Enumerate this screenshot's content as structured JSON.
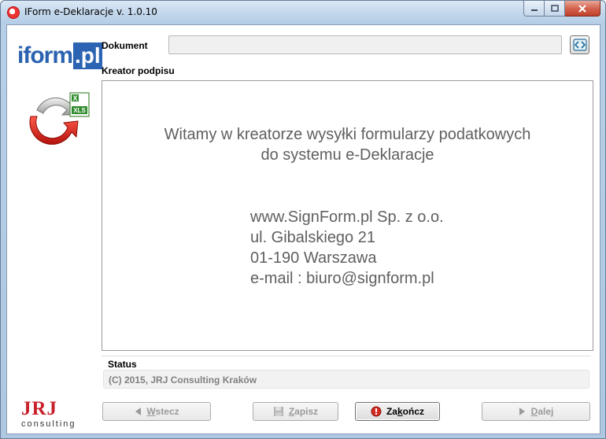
{
  "window": {
    "title": "IForm e-Deklaracje v. 1.0.10",
    "controls": {
      "minimize_icon": "minimize-icon",
      "maximize_icon": "maximize-icon",
      "close_icon": "close-icon"
    }
  },
  "branding": {
    "logo_text": "iform",
    "logo_box": ".pl",
    "excel_icon": "excel-xls-refresh-icon",
    "jrj_big": "JRJ",
    "jrj_small": "consulting"
  },
  "document": {
    "label": "Dokument",
    "value": "",
    "browse_icon": "browse-icon"
  },
  "wizard": {
    "label": "Kreator podpisu",
    "welcome_line1": "Witamy w kreatorze wysyłki formularzy podatkowych",
    "welcome_line2": "do systemu e-Deklaracje",
    "company_lines": [
      "www.SignForm.pl Sp. z o.o.",
      "ul. Gibalskiego 21",
      "01-190 Warszawa",
      "e-mail : biuro@signform.pl"
    ]
  },
  "status": {
    "label": "Status",
    "text": "(C) 2015,  JRJ Consulting Kraków"
  },
  "buttons": {
    "back": {
      "mnemonic": "W",
      "rest": "stecz",
      "enabled": false
    },
    "save": {
      "mnemonic": "Z",
      "rest": "apisz",
      "enabled": false
    },
    "finish": {
      "prefix": "Za",
      "mnemonic": "k",
      "rest": "ończ",
      "enabled": true
    },
    "next": {
      "mnemonic": "D",
      "rest": "alej",
      "enabled": false
    }
  },
  "colors": {
    "accent_blue": "#2c63b2",
    "jrj_red": "#c8202a",
    "disabled_text": "#9a9a9a",
    "welcome_text": "#5f5f5f"
  }
}
